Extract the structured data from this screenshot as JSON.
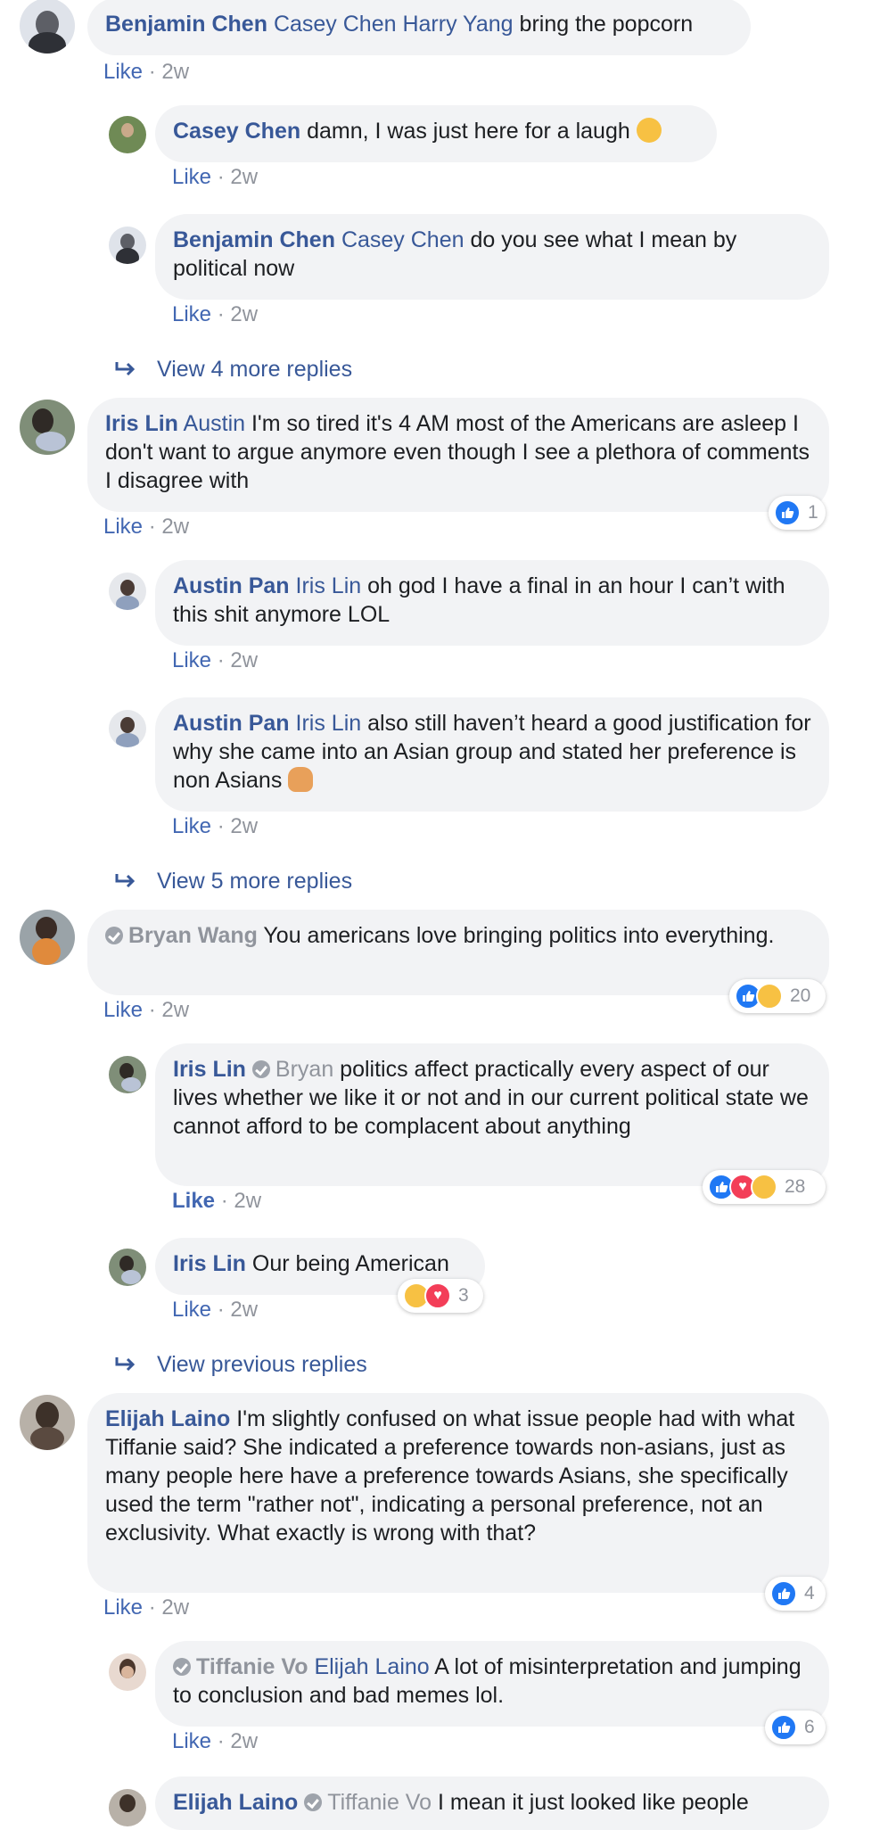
{
  "labels": {
    "like": "Like",
    "sep": "·"
  },
  "comments": [
    {
      "author": "Benjamin Chen",
      "tags": "Casey Chen Harry Yang",
      "text": " bring the popcorn",
      "time": "2w"
    },
    {
      "author": "Casey Chen",
      "text": " damn, I was just here for a laugh",
      "time": "2w"
    },
    {
      "author": "Benjamin Chen",
      "tags": "Casey Chen",
      "text": " do you see what I mean by political now",
      "time": "2w"
    },
    {
      "author": "Iris Lin",
      "tags": "Austin",
      "text": " I'm so tired it's 4 AM most of the Americans are asleep I don't want to argue anymore even though I see a plethora of comments I disagree with",
      "time": "2w",
      "reactions": "1"
    },
    {
      "author": "Austin Pan",
      "tags": "Iris Lin",
      "text": " oh god I have a final in an hour I can’t with this shit anymore LOL",
      "time": "2w"
    },
    {
      "author": "Austin Pan",
      "tags": "Iris Lin",
      "text": " also still haven’t heard a good justification for why she came into an Asian group and stated her preference is non Asians",
      "time": "2w"
    },
    {
      "author": "Bryan Wang",
      "text": " You americans love bringing politics into everything.",
      "time": "2w",
      "reactions": "20"
    },
    {
      "author": "Iris Lin",
      "tags": "Bryan",
      "text": " politics affect practically every aspect of our lives whether we like it or not and in our current political state we cannot afford to be complacent about anything",
      "time": "2w",
      "reactions": "28"
    },
    {
      "author": "Iris Lin",
      "text": " Our being American",
      "time": "2w",
      "reactions": "3"
    },
    {
      "author": "Elijah Laino",
      "text": " I'm slightly confused on what issue people had with what Tiffanie said? She indicated a preference towards non-asians, just as many people here have a preference towards Asians, she specifically used the term \"rather not\", indicating a personal preference, not an exclusivity. What exactly is wrong with that?",
      "time": "2w",
      "reactions": "4"
    },
    {
      "author": "Tiffanie Vo",
      "tags": "Elijah Laino",
      "text": " A lot of misinterpretation and jumping to conclusion and bad memes lol.",
      "time": "2w",
      "reactions": "6"
    },
    {
      "author": "Elijah Laino",
      "tags": "Tiffanie Vo",
      "text": " I mean it just looked like people"
    }
  ],
  "view_more": [
    {
      "label": "View 4 more replies"
    },
    {
      "label": "View 5 more replies"
    },
    {
      "label": "View previous replies"
    }
  ],
  "colors": {
    "link": "#385898",
    "like": "#4267b2",
    "bubble": "#f2f3f5",
    "meta": "#90949c"
  },
  "icons": [
    "verified-badge-icon",
    "like-reaction-icon",
    "love-reaction-icon",
    "haha-reaction-icon",
    "sad-reaction-icon",
    "reply-arrow-icon"
  ]
}
